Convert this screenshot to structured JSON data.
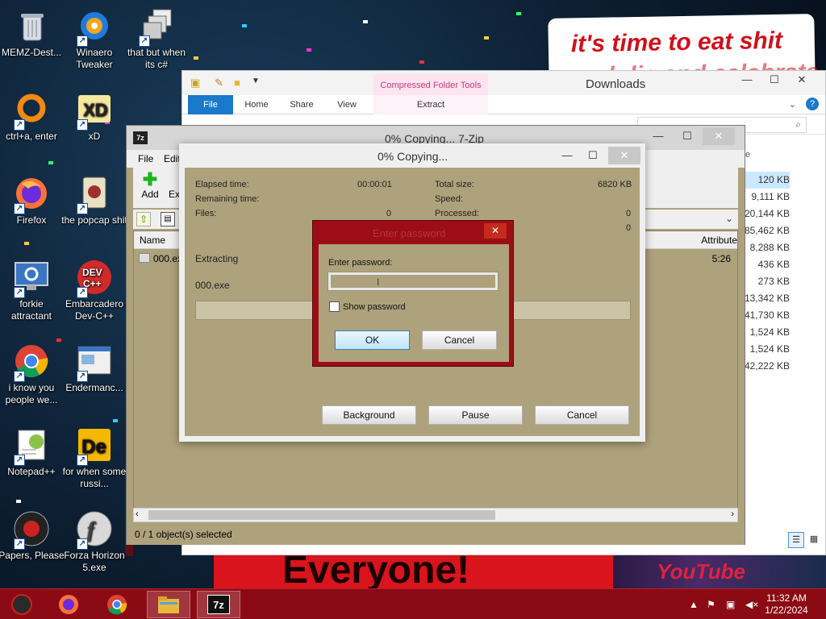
{
  "wallpaper": {
    "banner_top_line1": "it's time to eat shit",
    "banner_top_line2": "and die and celebrate",
    "banner_bottom": "Everyone!",
    "bottom_right_text": "YouTube"
  },
  "desktop_icons": [
    {
      "label": "MEMZ-Dest...",
      "icon": "recycle-bin-icon"
    },
    {
      "label": "Winaero Tweaker",
      "icon": "winaero-icon"
    },
    {
      "label": "that but when its c#",
      "icon": "windows-copy-icon"
    },
    {
      "label": "ctrl+a, enter",
      "icon": "ring-icon"
    },
    {
      "label": "xD",
      "icon": "hxd-icon"
    },
    {
      "label": "Firefox",
      "icon": "firefox-icon"
    },
    {
      "label": "the popcap shit",
      "icon": "popcap-icon"
    },
    {
      "label": "forkie attractant",
      "icon": "monitor-gear-icon"
    },
    {
      "label": "Embarcadero Dev-C++",
      "icon": "devcpp-icon"
    },
    {
      "label": "i know you people we...",
      "icon": "chrome-icon"
    },
    {
      "label": "Endermanc...",
      "icon": "window-app-icon"
    },
    {
      "label": "Notepad++",
      "icon": "notepadpp-icon"
    },
    {
      "label": "for when some russi...",
      "icon": "de-icon"
    },
    {
      "label": "Papers, Please",
      "icon": "papers-please-icon"
    },
    {
      "label": "Forza Horizon 5.exe",
      "icon": "flash-icon"
    }
  ],
  "explorer": {
    "title": "Downloads",
    "context_tab_header": "Compressed Folder Tools",
    "tabs": [
      "File",
      "Home",
      "Share",
      "View"
    ],
    "context_tab": "Extract",
    "sizes": [
      "120 KB",
      "9,111 KB",
      "20,144 KB",
      "85,462 KB",
      "8,288 KB",
      "436 KB",
      "273 KB",
      "13,342 KB",
      "41,730 KB",
      "1,524 KB",
      "1,524 KB",
      "42,222 KB"
    ],
    "column_partial": "e"
  },
  "sevenzip": {
    "title": "0% Copying... 7-Zip",
    "menu": [
      "File",
      "Edit"
    ],
    "toolbar_add": "Add",
    "toolbar_extract_partial": "Ext",
    "column_name": "Name",
    "column_attributes": "Attribute",
    "row_name": "000.exe",
    "row_time_partial": "5:26",
    "status": "0 / 1 object(s) selected"
  },
  "progress": {
    "title": "0% Copying...",
    "elapsed_label": "Elapsed time:",
    "elapsed_value": "00:00:01",
    "remaining_label": "Remaining time:",
    "files_label": "Files:",
    "files_value": "0",
    "total_size_label": "Total size:",
    "total_size_value": "6820 KB",
    "speed_label": "Speed:",
    "processed_label": "Processed:",
    "processed_value": "0",
    "extra_value": "0",
    "action": "Extracting",
    "file": "000.exe",
    "btn_background": "Background",
    "btn_pause": "Pause",
    "btn_cancel": "Cancel"
  },
  "password_dialog": {
    "title": "Enter password",
    "label": "Enter password:",
    "value": "",
    "show_password": "Show password",
    "ok": "OK",
    "cancel": "Cancel"
  },
  "taskbar": {
    "time": "11:32 AM",
    "date": "1/22/2024",
    "apps": [
      "memz-icon",
      "firefox-icon",
      "chrome-icon",
      "file-explorer-icon",
      "7zip-icon"
    ]
  },
  "colors": {
    "accent": "#1979ca",
    "taskbar": "#8b0a14",
    "dialog_bg": "#ada27c",
    "password_frame": "#9c0d16",
    "close_red": "#c42b1c"
  }
}
